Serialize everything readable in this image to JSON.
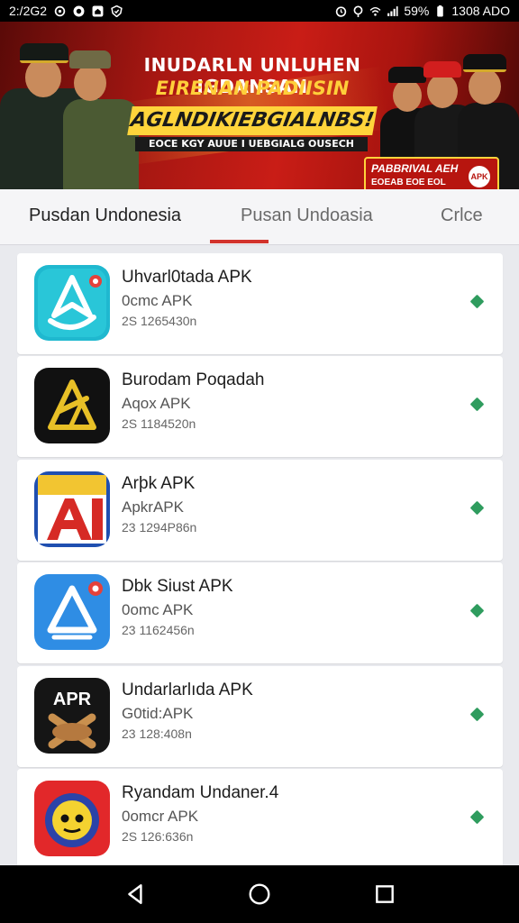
{
  "status_bar": {
    "time_left": "2:/2G2",
    "right_text": "1308 ADO",
    "battery": "59%",
    "icons_left": [
      "settings-icon",
      "record-icon",
      "home-icon",
      "shield-icon"
    ],
    "icons_right": [
      "alarm-icon",
      "location-icon",
      "wifi-icon",
      "signal-icon",
      "battery-icon"
    ]
  },
  "banner": {
    "line1": "INUDARLN UNLUHEN IGDANSAN",
    "line2": "EIRENAN PADIISIN",
    "line3": "AGLNDIKIEBGIALNBS!",
    "line4": "EOCE KGY AUUE I UEBGIALG OUSECH",
    "badge_line1": "PABBRIVAL AEH",
    "badge_line2": "EOEAB EOE EOL",
    "badge_icon_text": "APK",
    "colors": {
      "primary": "#c91d16",
      "accent": "#ffd43b"
    }
  },
  "tabs": [
    {
      "label": "Pusdan Undonesia",
      "active": false
    },
    {
      "label": "Pusan Undoasia",
      "active": true
    },
    {
      "label": "Crlce",
      "active": false
    }
  ],
  "apps": [
    {
      "title": "Uhvarl0tada APK",
      "subtitle": "0cmc APK",
      "meta": "2S 1265430n",
      "icon": "blue-arrow-app-icon"
    },
    {
      "title": "Burodam Poqadah",
      "subtitle": "Aqox APK",
      "meta": "2S 1184520n",
      "icon": "black-gold-app-icon"
    },
    {
      "title": "Arþk APK",
      "subtitle": "ApkrAPK",
      "meta": "23 1294P86n",
      "icon": "red-a-app-icon"
    },
    {
      "title": "Dbk Siust APK",
      "subtitle": "0omc APK",
      "meta": "23 1162456n",
      "icon": "blue-triangle-app-icon"
    },
    {
      "title": "Undarlarlıda APK",
      "subtitle": "G0tid:APK",
      "meta": "23 128:408n",
      "icon": "apr-app-icon"
    },
    {
      "title": "Ryandam Undaner.4",
      "subtitle": "0omcr APK",
      "meta": "2S 126:636n",
      "icon": "sun-face-app-icon"
    }
  ],
  "nav": [
    "back-icon",
    "home-icon",
    "recents-icon"
  ]
}
